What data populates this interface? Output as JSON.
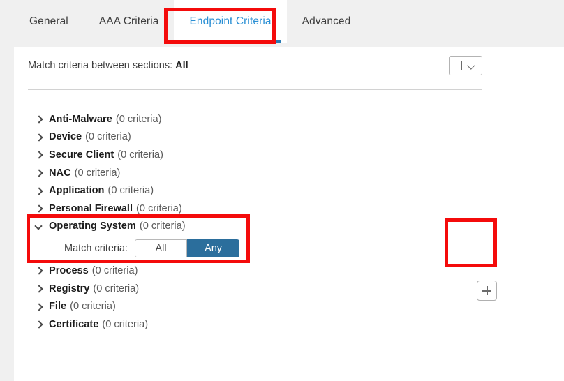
{
  "tabs": [
    {
      "label": "General",
      "active": false
    },
    {
      "label": "AAA Criteria",
      "active": false
    },
    {
      "label": "Endpoint Criteria",
      "active": true
    },
    {
      "label": "Advanced",
      "active": false
    }
  ],
  "match_between": {
    "label": "Match criteria between sections:",
    "value": "All"
  },
  "add_menu_button": {
    "plus_icon": "plus-icon",
    "chevron_icon": "chevron-down-icon"
  },
  "criteria": [
    {
      "name": "Anti-Malware",
      "count": "(0 criteria)",
      "expanded": false
    },
    {
      "name": "Device",
      "count": "(0 criteria)",
      "expanded": false
    },
    {
      "name": "Secure Client",
      "count": "(0 criteria)",
      "expanded": false
    },
    {
      "name": "NAC",
      "count": "(0 criteria)",
      "expanded": false
    },
    {
      "name": "Application",
      "count": "(0 criteria)",
      "expanded": false
    },
    {
      "name": "Personal Firewall",
      "count": "(0 criteria)",
      "expanded": false
    },
    {
      "name": "Operating System",
      "count": "(0 criteria)",
      "expanded": true
    },
    {
      "name": "Process",
      "count": "(0 criteria)",
      "expanded": false
    },
    {
      "name": "Registry",
      "count": "(0 criteria)",
      "expanded": false
    },
    {
      "name": "File",
      "count": "(0 criteria)",
      "expanded": false
    },
    {
      "name": "Certificate",
      "count": "(0 criteria)",
      "expanded": false
    }
  ],
  "os_section": {
    "match_criteria_label": "Match criteria:",
    "options": [
      "All",
      "Any"
    ],
    "selected": "Any",
    "add_button_icon": "plus-icon"
  },
  "colors": {
    "accent_blue": "#2a8fd4",
    "tab_underline": "#2b7cb5",
    "toggle_selected": "#2b6e9c",
    "annotation_red": "#f40b0b",
    "page_bg": "#f0f0f0",
    "card_bg": "#ffffff"
  }
}
